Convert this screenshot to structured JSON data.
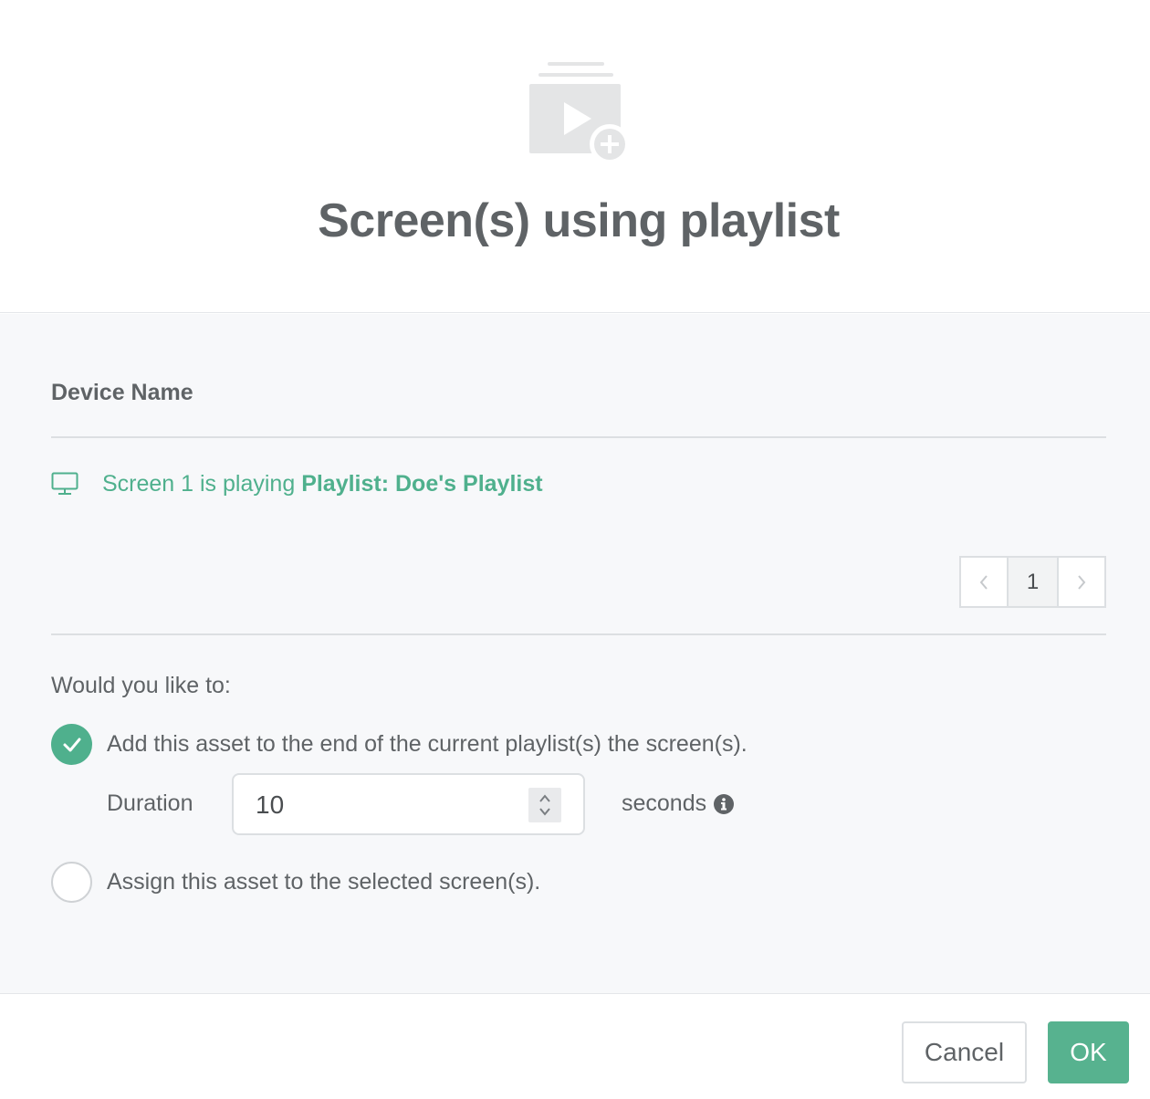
{
  "header": {
    "icon": "playlist-add-icon",
    "title": "Screen(s) using playlist"
  },
  "devices": {
    "column_header": "Device Name",
    "rows": [
      {
        "icon": "monitor-icon",
        "prefix": "Screen 1 is playing ",
        "playlist": "Playlist: Doe's Playlist"
      }
    ]
  },
  "pagination": {
    "prev": "‹",
    "current_page": "1",
    "next": "›"
  },
  "options": {
    "question": "Would you like to:",
    "add_label": "Add this asset to the end of the current playlist(s) the screen(s).",
    "add_selected": true,
    "duration_label": "Duration",
    "duration_value": "10",
    "duration_unit": "seconds",
    "assign_label": "Assign this asset to the selected screen(s).",
    "assign_selected": false
  },
  "footer": {
    "cancel_label": "Cancel",
    "ok_label": "OK"
  },
  "colors": {
    "accent": "#57b28f",
    "link": "#4fb08d",
    "text": "#5f6366",
    "body_bg": "#f7f8fa"
  }
}
